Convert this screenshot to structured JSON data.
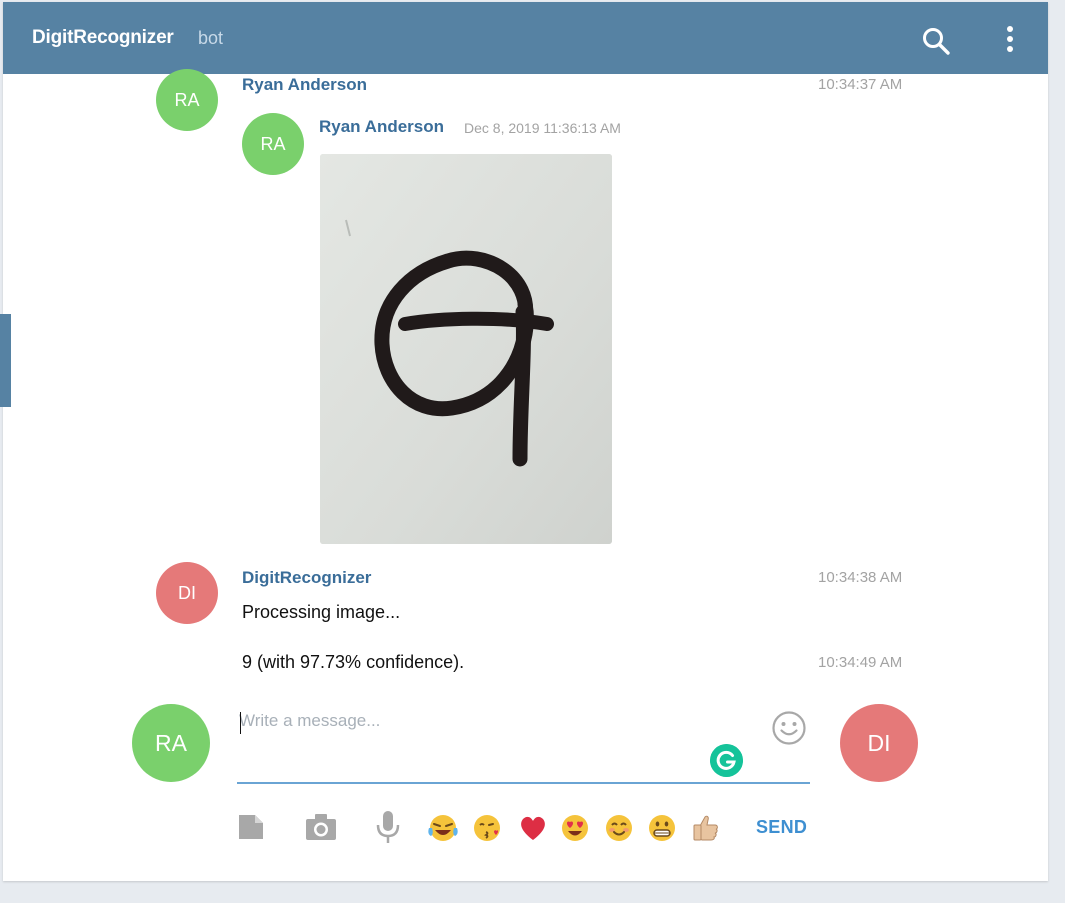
{
  "header": {
    "title": "DigitRecognizer",
    "subtitle": "bot"
  },
  "messages": [
    {
      "avatar_initials": "RA",
      "author": "Ryan Anderson",
      "time": "10:34:37 AM",
      "forwarded": {
        "avatar_initials": "RA",
        "author": "Ryan Anderson",
        "date": "Dec 8, 2019 11:36:13 AM",
        "photo": "photo of a handwritten digit 9 on white paper"
      }
    },
    {
      "avatar_initials": "DI",
      "author": "DigitRecognizer",
      "time": "10:34:38 AM",
      "text": "Processing image..."
    },
    {
      "text": "9 (with 97.73% confidence).",
      "time": "10:34:49 AM"
    }
  ],
  "composer": {
    "self_initials": "RA",
    "peer_initials": "DI",
    "placeholder": "Write a message...",
    "value": "",
    "send_label": "SEND",
    "attach_icons": [
      "file-icon",
      "camera-icon",
      "microphone-icon"
    ],
    "quick_emoji": [
      "😂",
      "😘",
      "❤️",
      "😍",
      "😊",
      "😁",
      "👍🏼"
    ]
  },
  "colors": {
    "header": "#5682a3",
    "author": "#3a6d99",
    "avatar_ra": "#7ad06c",
    "avatar_di": "#e57979",
    "send": "#3e8fd1",
    "input_underline": "#6aa4d4"
  }
}
